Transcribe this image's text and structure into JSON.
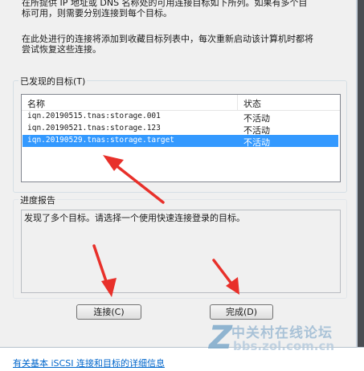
{
  "intro": {
    "line1": "在所提供 IP 地址或 DNS 名称处的可用连接目标如下所列。如果有多个目",
    "line2": "标可用，则需要分别连接到每个目标。",
    "line3": "在此处进行的连接将添加到收藏目标列表中，每次重新启动该计算机时都将",
    "line4": "尝试恢复这些连接。"
  },
  "targets_group": {
    "legend": "已发现的目标(T)",
    "columns": {
      "name": "名称",
      "status": "状态"
    },
    "rows": [
      {
        "name": "iqn.20190515.tnas:storage.001",
        "status": "不活动"
      },
      {
        "name": "iqn.20190521.tnas:storage.123",
        "status": "不活动"
      },
      {
        "name": "iqn.20190529.tnas:storage.target",
        "status": "不活动"
      }
    ],
    "selected_index": 2
  },
  "progress_group": {
    "legend": "进度报告",
    "message": "发现了多个目标。请选择一个使用快速连接登录的目标。"
  },
  "buttons": {
    "connect": "连接(C)",
    "done": "完成(D)"
  },
  "footer": {
    "link": "有关基本 iSCSI 连接和目标的详细信息"
  },
  "watermark": {
    "logo": "Z",
    "site_name": "中关村在线论坛",
    "url": "bbs.zol.com.cn"
  },
  "colors": {
    "selection": "#3399ff",
    "annotation_arrow": "#e8302a",
    "link": "#0066cc"
  }
}
